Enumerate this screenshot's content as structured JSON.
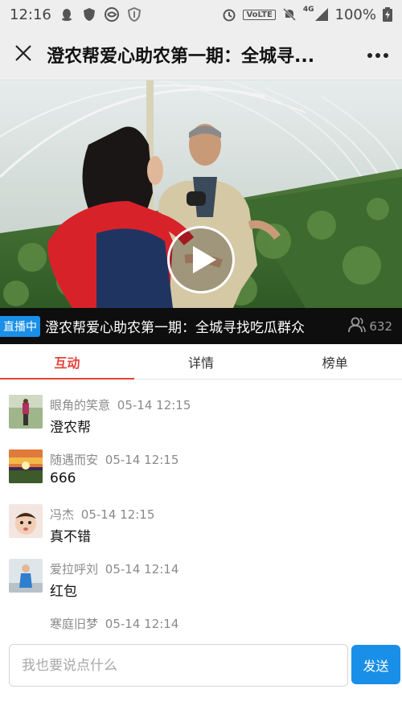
{
  "status_bar": {
    "time": "12:16",
    "network_label": "VoLTE",
    "signal_label": "4G",
    "battery": "100%"
  },
  "header": {
    "title": "澄农帮爱心助农第一期：全城寻..."
  },
  "live": {
    "badge": "直播中",
    "title": "澄农帮爱心助农第一期：全城寻找吃瓜群众",
    "viewers": "632"
  },
  "tabs": [
    {
      "label": "互动",
      "active": true
    },
    {
      "label": "详情",
      "active": false
    },
    {
      "label": "榜单",
      "active": false
    }
  ],
  "comments": [
    {
      "user": "眼角的笑意",
      "time": "05-14 12:15",
      "text": "澄农帮",
      "avatar": "person-walking"
    },
    {
      "user": "随遇而安",
      "time": "05-14 12:15",
      "text": "666",
      "avatar": "sunset"
    },
    {
      "user": "冯杰",
      "time": "05-14 12:15",
      "text": "真不错",
      "avatar": "baby"
    },
    {
      "user": "爱拉呼刘",
      "time": "05-14 12:14",
      "text": "红包",
      "avatar": "person-standing"
    },
    {
      "user": "寒庭旧梦",
      "time": "05-14 12:14",
      "text": "",
      "avatar": "none"
    }
  ],
  "input": {
    "placeholder": "我也要说点什么",
    "send_label": "发送"
  },
  "colors": {
    "accent_red": "#e4433a",
    "accent_blue": "#1a8fe8"
  }
}
